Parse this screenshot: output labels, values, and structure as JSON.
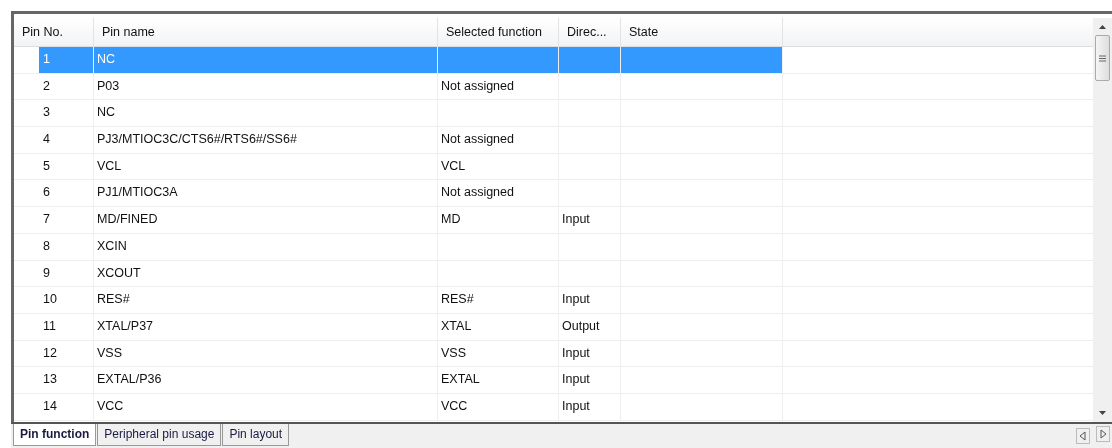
{
  "table": {
    "columns": [
      "Pin No.",
      "Pin name",
      "Selected function",
      "Direc...",
      "State"
    ],
    "rows": [
      {
        "cells": [
          "1",
          "NC",
          "",
          "",
          ""
        ],
        "selected": true
      },
      {
        "cells": [
          "2",
          "P03",
          "Not assigned",
          "",
          ""
        ],
        "selected": false
      },
      {
        "cells": [
          "3",
          "NC",
          "",
          "",
          ""
        ],
        "selected": false
      },
      {
        "cells": [
          "4",
          "PJ3/MTIOC3C/CTS6#/RTS6#/SS6#",
          "Not assigned",
          "",
          ""
        ],
        "selected": false
      },
      {
        "cells": [
          "5",
          "VCL",
          "VCL",
          "",
          ""
        ],
        "selected": false
      },
      {
        "cells": [
          "6",
          "PJ1/MTIOC3A",
          "Not assigned",
          "",
          ""
        ],
        "selected": false
      },
      {
        "cells": [
          "7",
          "MD/FINED",
          "MD",
          "Input",
          ""
        ],
        "selected": false
      },
      {
        "cells": [
          "8",
          "XCIN",
          "",
          "",
          ""
        ],
        "selected": false
      },
      {
        "cells": [
          "9",
          "XCOUT",
          "",
          "",
          ""
        ],
        "selected": false
      },
      {
        "cells": [
          "10",
          "RES#",
          "RES#",
          "Input",
          ""
        ],
        "selected": false
      },
      {
        "cells": [
          "11",
          "XTAL/P37",
          "XTAL",
          "Output",
          ""
        ],
        "selected": false
      },
      {
        "cells": [
          "12",
          "VSS",
          "VSS",
          "Input",
          ""
        ],
        "selected": false
      },
      {
        "cells": [
          "13",
          "EXTAL/P36",
          "EXTAL",
          "Input",
          ""
        ],
        "selected": false
      },
      {
        "cells": [
          "14",
          "VCC",
          "VCC",
          "Input",
          ""
        ],
        "selected": false
      }
    ]
  },
  "tabs": [
    {
      "label": "Pin function",
      "selected": true
    },
    {
      "label": "Peripheral pin usage",
      "selected": false
    },
    {
      "label": "Pin layout",
      "selected": false
    }
  ]
}
